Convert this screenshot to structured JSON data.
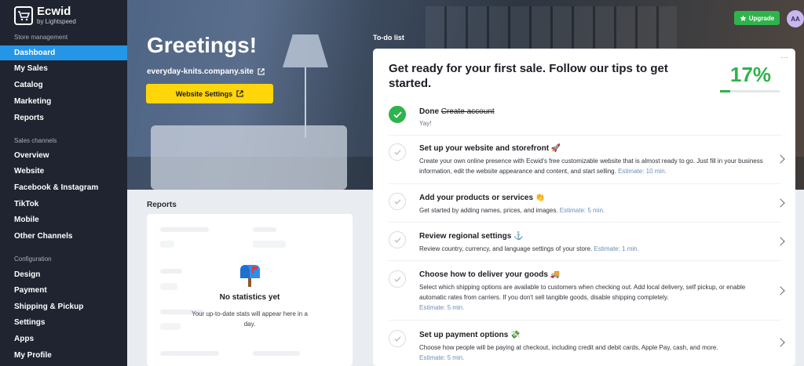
{
  "sidebar": {
    "logo_name": "Ecwid",
    "logo_sub": "by Lightspeed",
    "sections": {
      "store": "Store management",
      "channels": "Sales channels",
      "config": "Configuration"
    },
    "store_items": [
      "Dashboard",
      "My Sales",
      "Catalog",
      "Marketing",
      "Reports"
    ],
    "channel_items": [
      "Overview",
      "Website",
      "Facebook & Instagram",
      "TikTok",
      "Mobile",
      "Other Channels"
    ],
    "config_items": [
      "Design",
      "Payment",
      "Shipping & Pickup",
      "Settings",
      "Apps",
      "My Profile"
    ],
    "active": "Dashboard"
  },
  "hero": {
    "greeting": "Greetings!",
    "store_url": "everyday-knits.company.site",
    "website_settings": "Website Settings"
  },
  "header": {
    "upgrade": "Upgrade",
    "avatar": "AA"
  },
  "reports": {
    "title": "Reports",
    "empty_title": "No statistics yet",
    "empty_sub": "Your up-to-date stats will appear here in a day."
  },
  "todo": {
    "label": "To-do list",
    "heading": "Get ready for your first sale. Follow our tips to get started.",
    "percent": "17%",
    "progress": 0.17,
    "more": "…",
    "steps": [
      {
        "title_prefix": "Done",
        "title": "Create account",
        "sub": "Yay!",
        "done": true
      },
      {
        "title": "Set up your website and storefront 🚀",
        "desc": "Create your own online presence with Ecwid's free customizable website that is almost ready to go. Just fill in your business information, edit the website appearance and content, and start selling.",
        "estimate": "Estimate: 10 min."
      },
      {
        "title": "Add your products or services 👏",
        "desc": "Get started by adding names, prices, and images.",
        "estimate": "Estimate: 5 min."
      },
      {
        "title": "Review regional settings ⚓",
        "desc": "Review country, currency, and language settings of your store.",
        "estimate": "Estimate: 1 min."
      },
      {
        "title": "Choose how to deliver your goods 🚚",
        "desc": "Select which shipping options are available to customers when checking out. Add local delivery, self pickup, or enable automatic rates from carriers. If you don't sell tangible goods, disable shipping completely.",
        "estimate": "Estimate: 5 min."
      },
      {
        "title": "Set up payment options 💸",
        "desc": "Choose how people will be paying at checkout, including credit and debit cards, Apple Pay, cash, and more.",
        "estimate": "Estimate: 5 min."
      }
    ]
  }
}
